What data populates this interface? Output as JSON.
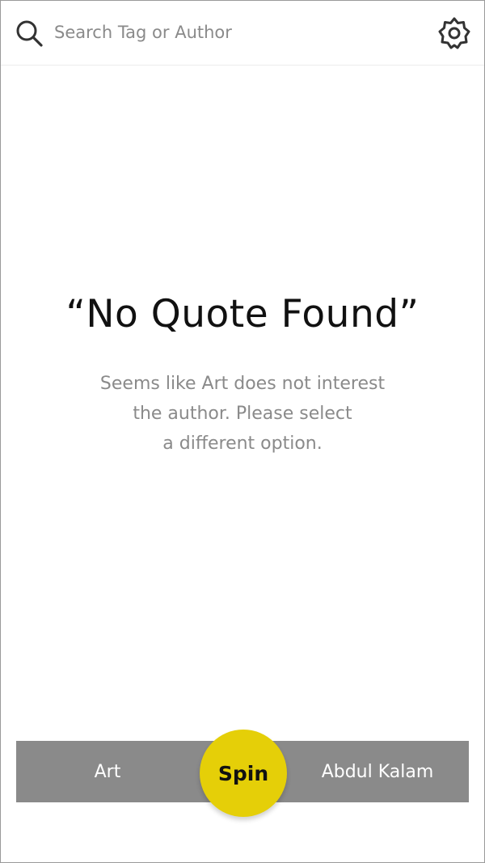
{
  "search": {
    "placeholder": "Search Tag or Author",
    "icon": "search-icon"
  },
  "settings": {
    "icon": "gear-icon"
  },
  "content": {
    "title": "“No Quote Found”",
    "message_lines": [
      "Seems like Art does not interest",
      "the author. Please select",
      "a different option."
    ]
  },
  "bottom_bar": {
    "tag_label": "Art",
    "spin_label": "Spin",
    "author_label": "Abdul Kalam"
  },
  "colors": {
    "accent": "#e5cf08",
    "bar": "#8a8a8a",
    "muted_text": "#8a8a8a",
    "title_text": "#111111"
  }
}
